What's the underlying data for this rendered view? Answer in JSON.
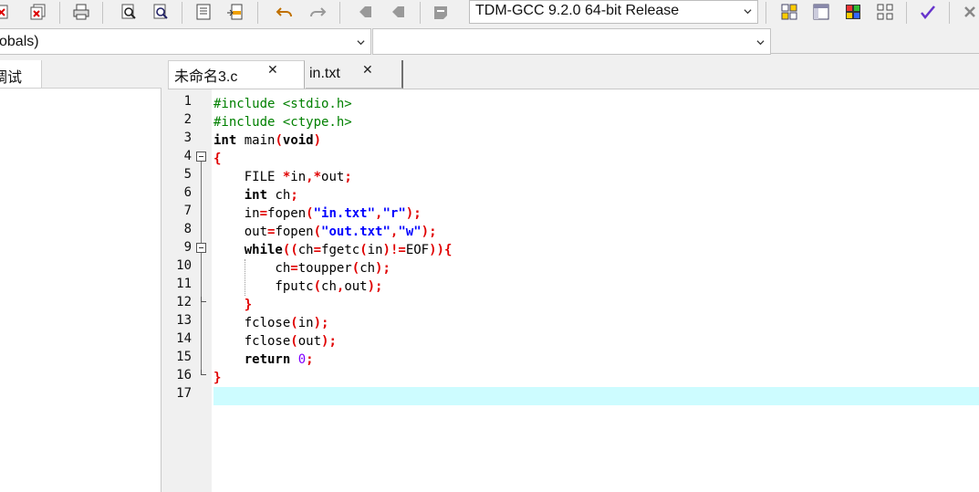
{
  "toolbar": {
    "compiler": "TDM-GCC 9.2.0 64-bit Release"
  },
  "scope": {
    "value": "obals)"
  },
  "left_panel": {
    "tab_label": "调试"
  },
  "tabs": [
    {
      "label": "未命名3.c",
      "close": "✕"
    },
    {
      "label": "in.txt",
      "close": "✕"
    }
  ],
  "editor": {
    "highlight_color": "#cdfcff",
    "line_numbers": [
      "1",
      "2",
      "3",
      "4",
      "5",
      "6",
      "7",
      "8",
      "9",
      "10",
      "11",
      "12",
      "13",
      "14",
      "15",
      "16",
      "17"
    ],
    "lines": [
      "#include <stdio.h>",
      "#include <ctype.h>",
      "int main(void)",
      "{",
      "    FILE *in,*out;",
      "    int ch;",
      "    in=fopen(\"in.txt\",\"r\");",
      "    out=fopen(\"out.txt\",\"w\");",
      "    while((ch=fgetc(in)!=EOF)){",
      "        ch=toupper(ch);",
      "        fputc(ch,out);",
      "    }",
      "    fclose(in);",
      "    fclose(out);",
      "    return 0;",
      "}",
      ""
    ]
  }
}
